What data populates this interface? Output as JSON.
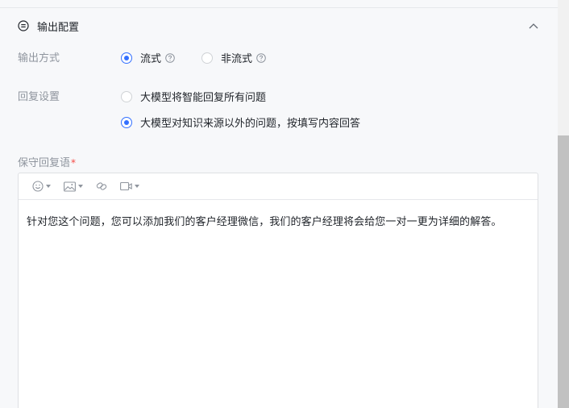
{
  "section": {
    "title": "输出配置"
  },
  "output_mode": {
    "label": "输出方式",
    "options": [
      {
        "label": "流式",
        "selected": true
      },
      {
        "label": "非流式",
        "selected": false
      }
    ]
  },
  "reply_settings": {
    "label": "回复设置",
    "options": [
      {
        "label": "大模型将智能回复所有问题",
        "selected": false
      },
      {
        "label": "大模型对知识来源以外的问题，按填写内容回答",
        "selected": true
      }
    ]
  },
  "fallback": {
    "label": "保守回复语",
    "required_mark": "*",
    "content": "针对您这个问题，您可以添加我们的客户经理微信，我们的客户经理将会给您一对一更为详细的解答。"
  },
  "colors": {
    "accent": "#3370ff",
    "required": "#f54a45",
    "label": "#8f959e"
  },
  "icons": {
    "section": "minus-circle-icon",
    "collapse": "chevron-up-icon",
    "help": "question-circle-icon",
    "toolbar": [
      "emoji-icon",
      "image-icon",
      "link-icon",
      "video-icon"
    ]
  }
}
